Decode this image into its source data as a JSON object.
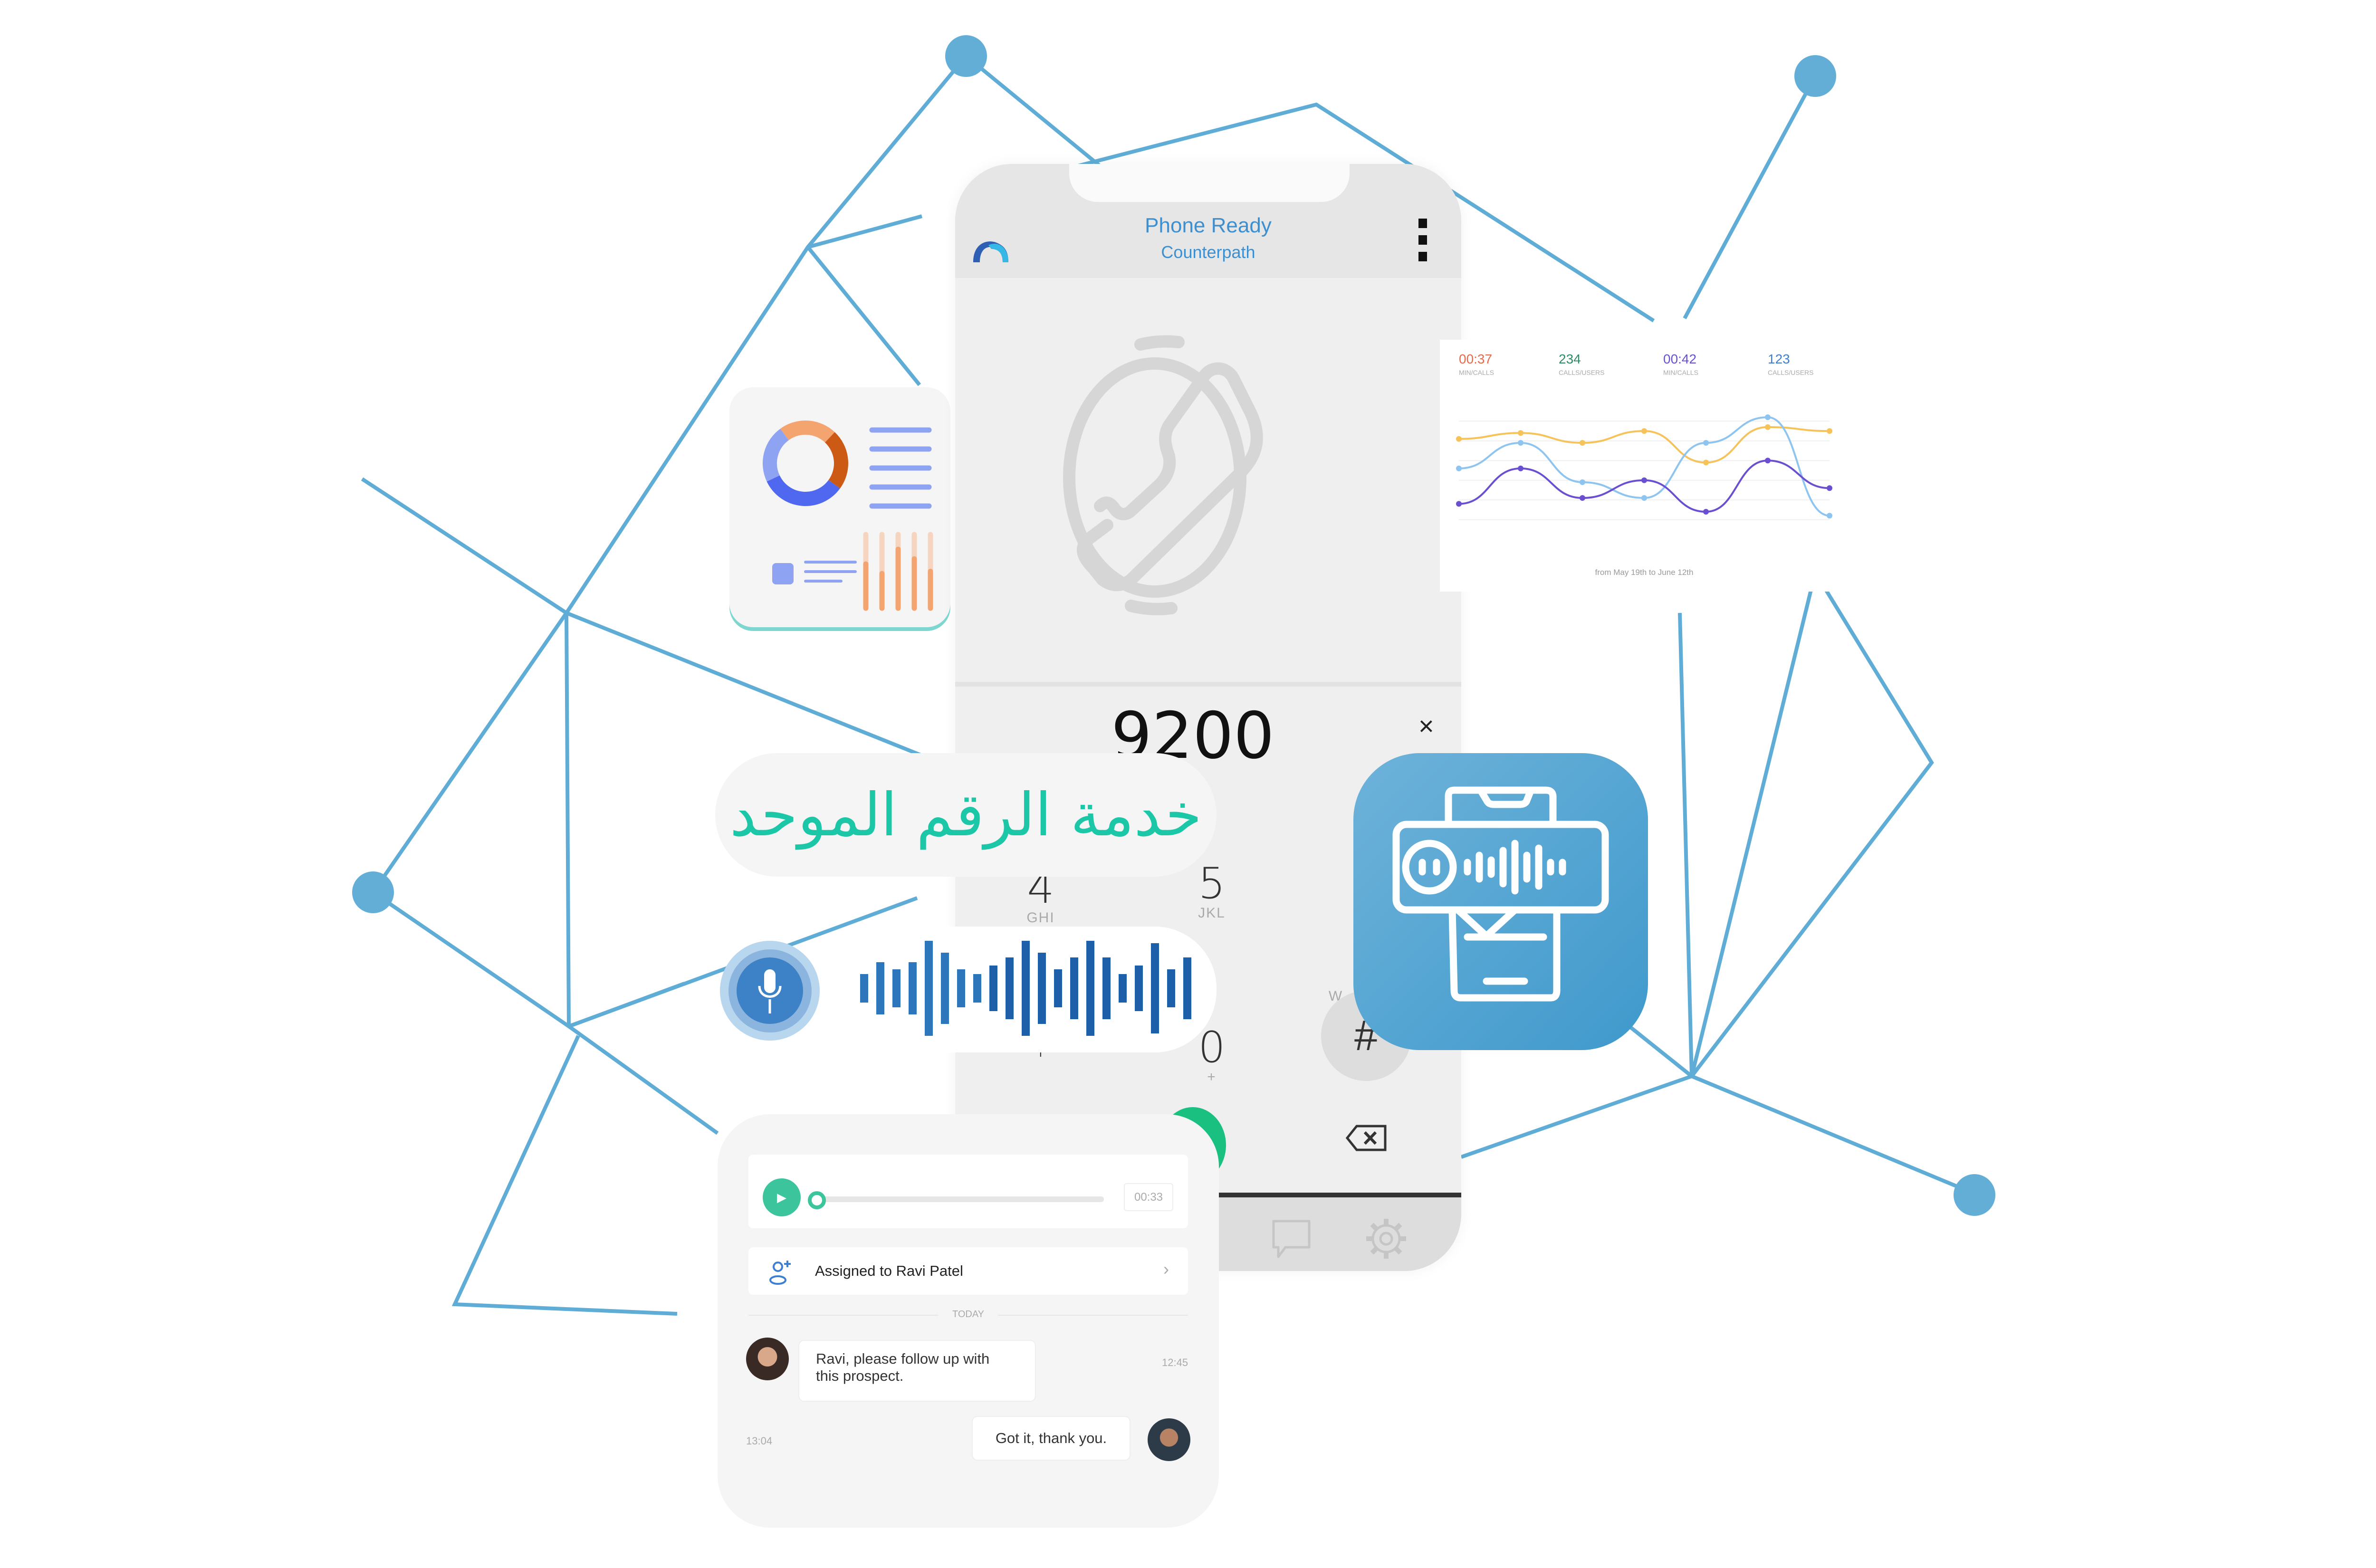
{
  "phone": {
    "title": "Phone Ready",
    "subtitle": "Counterpath",
    "dialed_number": "9200",
    "clear_label": "×",
    "keys": [
      {
        "digit": "4",
        "letters": "GHI"
      },
      {
        "digit": "5",
        "letters": "JKL"
      },
      {
        "digit": "*",
        "letters": ""
      },
      {
        "digit": "0",
        "letters": "+"
      },
      {
        "digit": "#",
        "letters": ""
      }
    ],
    "partial_key_letters": "W",
    "nav_items": [
      "chat-icon",
      "gear-icon"
    ]
  },
  "service_label": "خدمة الرقم الموحد",
  "stats_card": {
    "stats": [
      {
        "value": "00:37",
        "label": "MIN/CALLS",
        "color": "#e8694a"
      },
      {
        "value": "234",
        "label": "CALLS/USERS",
        "color": "#2f8a66"
      },
      {
        "value": "00:42",
        "label": "MIN/CALLS",
        "color": "#6a4fd0"
      },
      {
        "value": "123",
        "label": "CALLS/USERS",
        "color": "#3d7fd0"
      }
    ],
    "caption": "from May 19th to June 12th"
  },
  "chart_data": {
    "type": "line",
    "title": "",
    "xlabel": "",
    "ylabel": "",
    "x": [
      1,
      2,
      3,
      4,
      5,
      6,
      7
    ],
    "ylim": [
      0,
      7
    ],
    "grid": true,
    "series": [
      {
        "name": "yellow",
        "color": "#f6c35a",
        "values": [
          5.1,
          5.4,
          4.9,
          5.5,
          3.9,
          5.7,
          5.5
        ]
      },
      {
        "name": "light-blue",
        "color": "#8ec4f0",
        "values": [
          3.6,
          4.9,
          2.9,
          2.1,
          4.9,
          6.2,
          1.2
        ]
      },
      {
        "name": "purple",
        "color": "#6a4fd0",
        "values": [
          1.8,
          3.6,
          2.1,
          3.0,
          1.4,
          4.0,
          2.6
        ]
      }
    ]
  },
  "dashboard_card": {
    "donut": [
      {
        "label": "peach",
        "value": 22,
        "color": "#f4a46f"
      },
      {
        "label": "rust",
        "value": 23,
        "color": "#cc5a14"
      },
      {
        "label": "blue",
        "value": 33,
        "color": "#4f68ef"
      },
      {
        "label": "light-blue",
        "value": 22,
        "color": "#8ea3f2"
      }
    ],
    "bars": [
      0.6,
      0.47,
      0.8,
      0.67,
      0.5
    ]
  },
  "waveform": [
    0.3,
    0.55,
    0.4,
    0.55,
    1.0,
    0.75,
    0.4,
    0.3,
    0.48,
    0.65,
    1.0,
    0.75,
    0.4,
    0.65,
    1.0,
    0.65,
    0.3,
    0.48,
    0.95,
    0.4,
    0.65
  ],
  "chat": {
    "audio_duration": "00:33",
    "audio_progress": 0,
    "assigned_label": "Assigned to Ravi Patel",
    "day_label": "TODAY",
    "messages": [
      {
        "text_line1": "Ravi, please follow up with",
        "text_line2": "this prospect.",
        "time": "12:45",
        "side": "left"
      },
      {
        "text": "Got it, thank you.",
        "time": "13:04",
        "side": "right"
      }
    ]
  },
  "colors": {
    "network": "#5fadd6",
    "accent_teal": "#1cc7a8",
    "call_green": "#1ac080",
    "app_icon_blue": "#4ea3d2",
    "wave_blue": "#1d5fa8"
  }
}
